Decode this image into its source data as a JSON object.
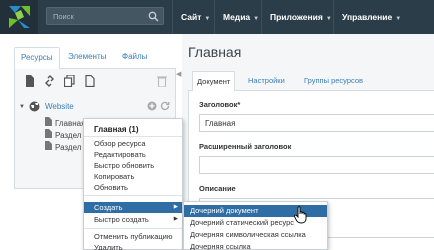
{
  "topbar": {
    "search_placeholder": "Поиск",
    "nav": [
      {
        "label": "Сайт"
      },
      {
        "label": "Медиа"
      },
      {
        "label": "Приложения"
      },
      {
        "label": "Управление"
      }
    ],
    "colors": {
      "bar": "#2b3d48",
      "logo_green": "#6fbf2b",
      "logo_blue": "#2a8ccb"
    }
  },
  "leftpanel": {
    "tabs": [
      "Ресурсы",
      "Элементы",
      "Файлы"
    ],
    "root_label": "Website",
    "items": [
      "Главная (1",
      "Раздел №",
      "Раздел №"
    ]
  },
  "main": {
    "title": "Главная",
    "tabs": [
      "Документ",
      "Настройки",
      "Группы ресурсов"
    ],
    "fields": [
      {
        "label": "Заголовок*",
        "value": "Главная"
      },
      {
        "label": "Расширенный заголовок",
        "value": ""
      },
      {
        "label": "Описание",
        "value": ""
      }
    ]
  },
  "context_menu": {
    "header": "Главная (1)",
    "items": [
      "Обзор ресурса",
      "Редактировать",
      "Быстро обновить",
      "Копировать",
      "Обновить",
      "Создать",
      "Быстро создать",
      "Отменить публикацию",
      "Удалить"
    ],
    "highlight_color": "#2f6ea5"
  },
  "submenu": {
    "items": [
      "Дочерний документ",
      "Дочерний статический ресурс",
      "Дочерняя символическая ссылка",
      "Дочерняя ссылка"
    ]
  }
}
